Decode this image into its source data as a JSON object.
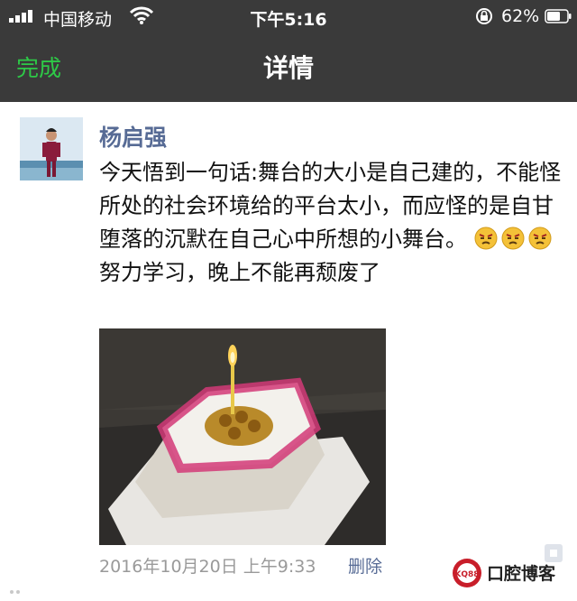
{
  "status_bar": {
    "carrier": "中国移动",
    "time": "下午5:16",
    "battery": "62%"
  },
  "nav": {
    "done_label": "完成",
    "title": "详情"
  },
  "post": {
    "author": "杨启强",
    "text_before_emoji": "今天悟到一句话:舞台的大小是自己建的，不能怪所处的社会环境给的平台太小，而应怪的是自甘堕落的沉默在自己心中所想的小舞台。",
    "emoji_name": "tired-face-emoji",
    "text_after_emoji": "努力学习，晚上不能再颓废了",
    "timestamp": "2016年10月20日 上午9:33",
    "delete_label": "删除"
  },
  "watermark": {
    "badge": "KQ88",
    "text": "口腔博客"
  },
  "colors": {
    "nav_bg": "#3a3a3a",
    "done_green": "#2ec947",
    "link_blue": "#576b95"
  }
}
